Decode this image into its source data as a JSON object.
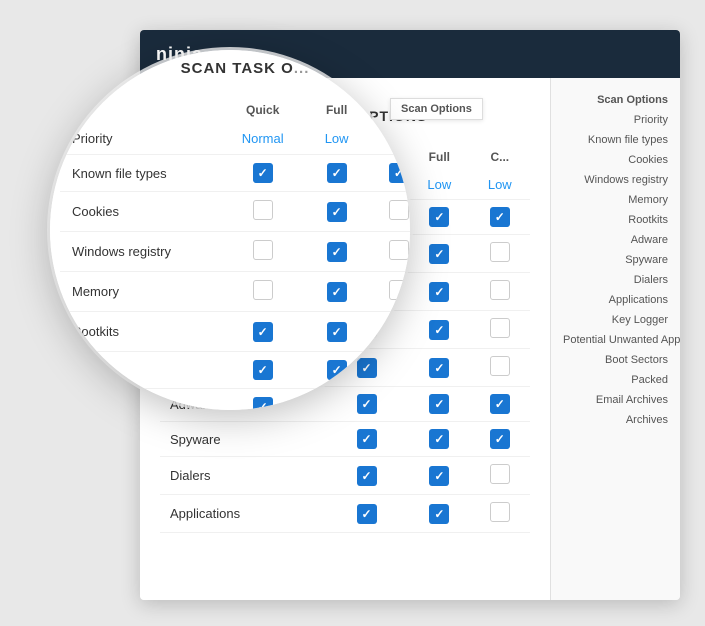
{
  "app": {
    "logo": "ninja",
    "title": "SCAN TASK OPTIONS"
  },
  "scan_table": {
    "columns": [
      "",
      "Quick",
      "Full",
      "C..."
    ],
    "scan_options_header": "Scan Options",
    "priority_row": {
      "label": "Priority",
      "quick": "Normal",
      "full": "Low",
      "custom": "Low"
    },
    "rows": [
      {
        "label": "Known file types",
        "quick": true,
        "full": true,
        "custom": true
      },
      {
        "label": "Cookies",
        "quick": false,
        "full": true,
        "custom": false
      },
      {
        "label": "Windows registry",
        "quick": false,
        "full": true,
        "custom": false
      },
      {
        "label": "Memory",
        "quick": false,
        "full": true,
        "custom": false
      },
      {
        "label": "Rootkits",
        "quick": true,
        "full": true,
        "custom": false
      },
      {
        "label": "Adware",
        "quick": true,
        "full": true,
        "custom": true
      },
      {
        "label": "Spyware",
        "quick": true,
        "full": true,
        "custom": true
      },
      {
        "label": "Dialers",
        "quick": true,
        "full": true,
        "custom": false
      },
      {
        "label": "Applications",
        "quick": true,
        "full": true,
        "custom": false
      }
    ]
  },
  "right_sidebar": {
    "header": "Scan Options",
    "items": [
      "Priority",
      "Known file types",
      "Cookies",
      "Windows registry",
      "Memory",
      "Rootkits",
      "Adware",
      "Spyware",
      "Dialers",
      "Applications",
      "Key Logger",
      "Potential Unwanted Applications",
      "Boot Sectors",
      "Packed",
      "Email Archives",
      "Archives"
    ]
  },
  "magnifier": {
    "title": "SCAN TASK O...",
    "columns": [
      "Quick",
      "Full",
      "C"
    ],
    "priority_row": {
      "label": "Priority",
      "quick": "Normal",
      "full": "Low",
      "custom": "Low"
    },
    "rows": [
      {
        "label": "Known file types",
        "quick": true,
        "full": true,
        "custom": true
      },
      {
        "label": "Cookies",
        "quick": false,
        "full": true,
        "custom": false
      },
      {
        "label": "Windows registry",
        "quick": false,
        "full": true,
        "custom": false
      },
      {
        "label": "Memory",
        "quick": false,
        "full": true,
        "custom": false
      },
      {
        "label": "Rootkits",
        "quick": true,
        "full": true,
        "custom": false
      },
      {
        "label": "Adware",
        "quick": true,
        "full": true,
        "custom": true
      },
      {
        "label": "Spyware",
        "quick": true,
        "full": true,
        "custom": true
      },
      {
        "label": "Dialers",
        "quick": true,
        "full": true,
        "custom": false
      },
      {
        "label": "Applications",
        "quick": true,
        "full": true,
        "custom": false
      }
    ]
  }
}
